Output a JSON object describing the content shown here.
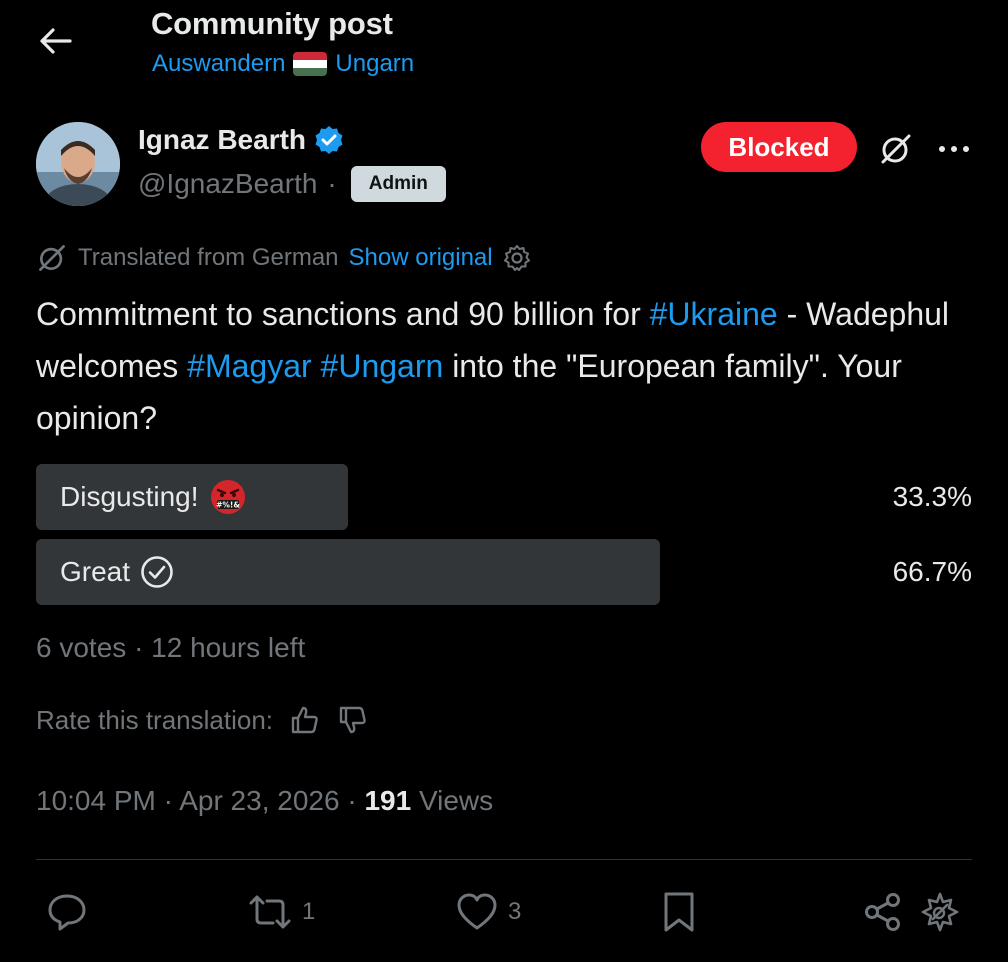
{
  "header": {
    "title": "Community post",
    "community_name_1": "Auswandern",
    "community_name_2": "Ungarn",
    "flag_icon": "hungary-flag-icon"
  },
  "author": {
    "name": "Ignaz Bearth",
    "handle": "@IgnazBearth",
    "separator": "·",
    "role_badge": "Admin",
    "verified": true
  },
  "actions_top": {
    "blocked_label": "Blocked",
    "blocked_color": "#f4212e"
  },
  "translation": {
    "label": "Translated from German",
    "show_original": "Show original"
  },
  "post": {
    "segments": [
      {
        "text": "Commitment to sanctions and 90 billion for ",
        "type": "text"
      },
      {
        "text": "#Ukraine",
        "type": "hashtag"
      },
      {
        "text": " - Wadephul welcomes ",
        "type": "text"
      },
      {
        "text": "#Magyar",
        "type": "hashtag"
      },
      {
        "text": " ",
        "type": "text"
      },
      {
        "text": "#Ungarn",
        "type": "hashtag"
      },
      {
        "text": " into the \"European family\". Your opinion?",
        "type": "text"
      }
    ]
  },
  "poll": {
    "options": [
      {
        "label": "Disgusting!",
        "percent_text": "33.3%",
        "fraction": 0.333,
        "icon": "angry-face-icon"
      },
      {
        "label": "Great",
        "percent_text": "66.7%",
        "fraction": 0.667,
        "icon": "check-circle-icon"
      }
    ],
    "votes": "6 votes",
    "separator": "·",
    "time_left": "12 hours left"
  },
  "rate": {
    "label": "Rate this translation:"
  },
  "meta": {
    "time": "10:04 PM",
    "date": "Apr 23, 2026",
    "separator": "·",
    "views_count": "191",
    "views_label": "Views"
  },
  "bottom_actions": {
    "reply_count": "",
    "repost_count": "1",
    "like_count": "3"
  },
  "colors": {
    "accent": "#1d9bf0",
    "muted": "#71767b",
    "text": "#e7e9ea",
    "background": "#000000",
    "poll_fill": "#333639"
  }
}
